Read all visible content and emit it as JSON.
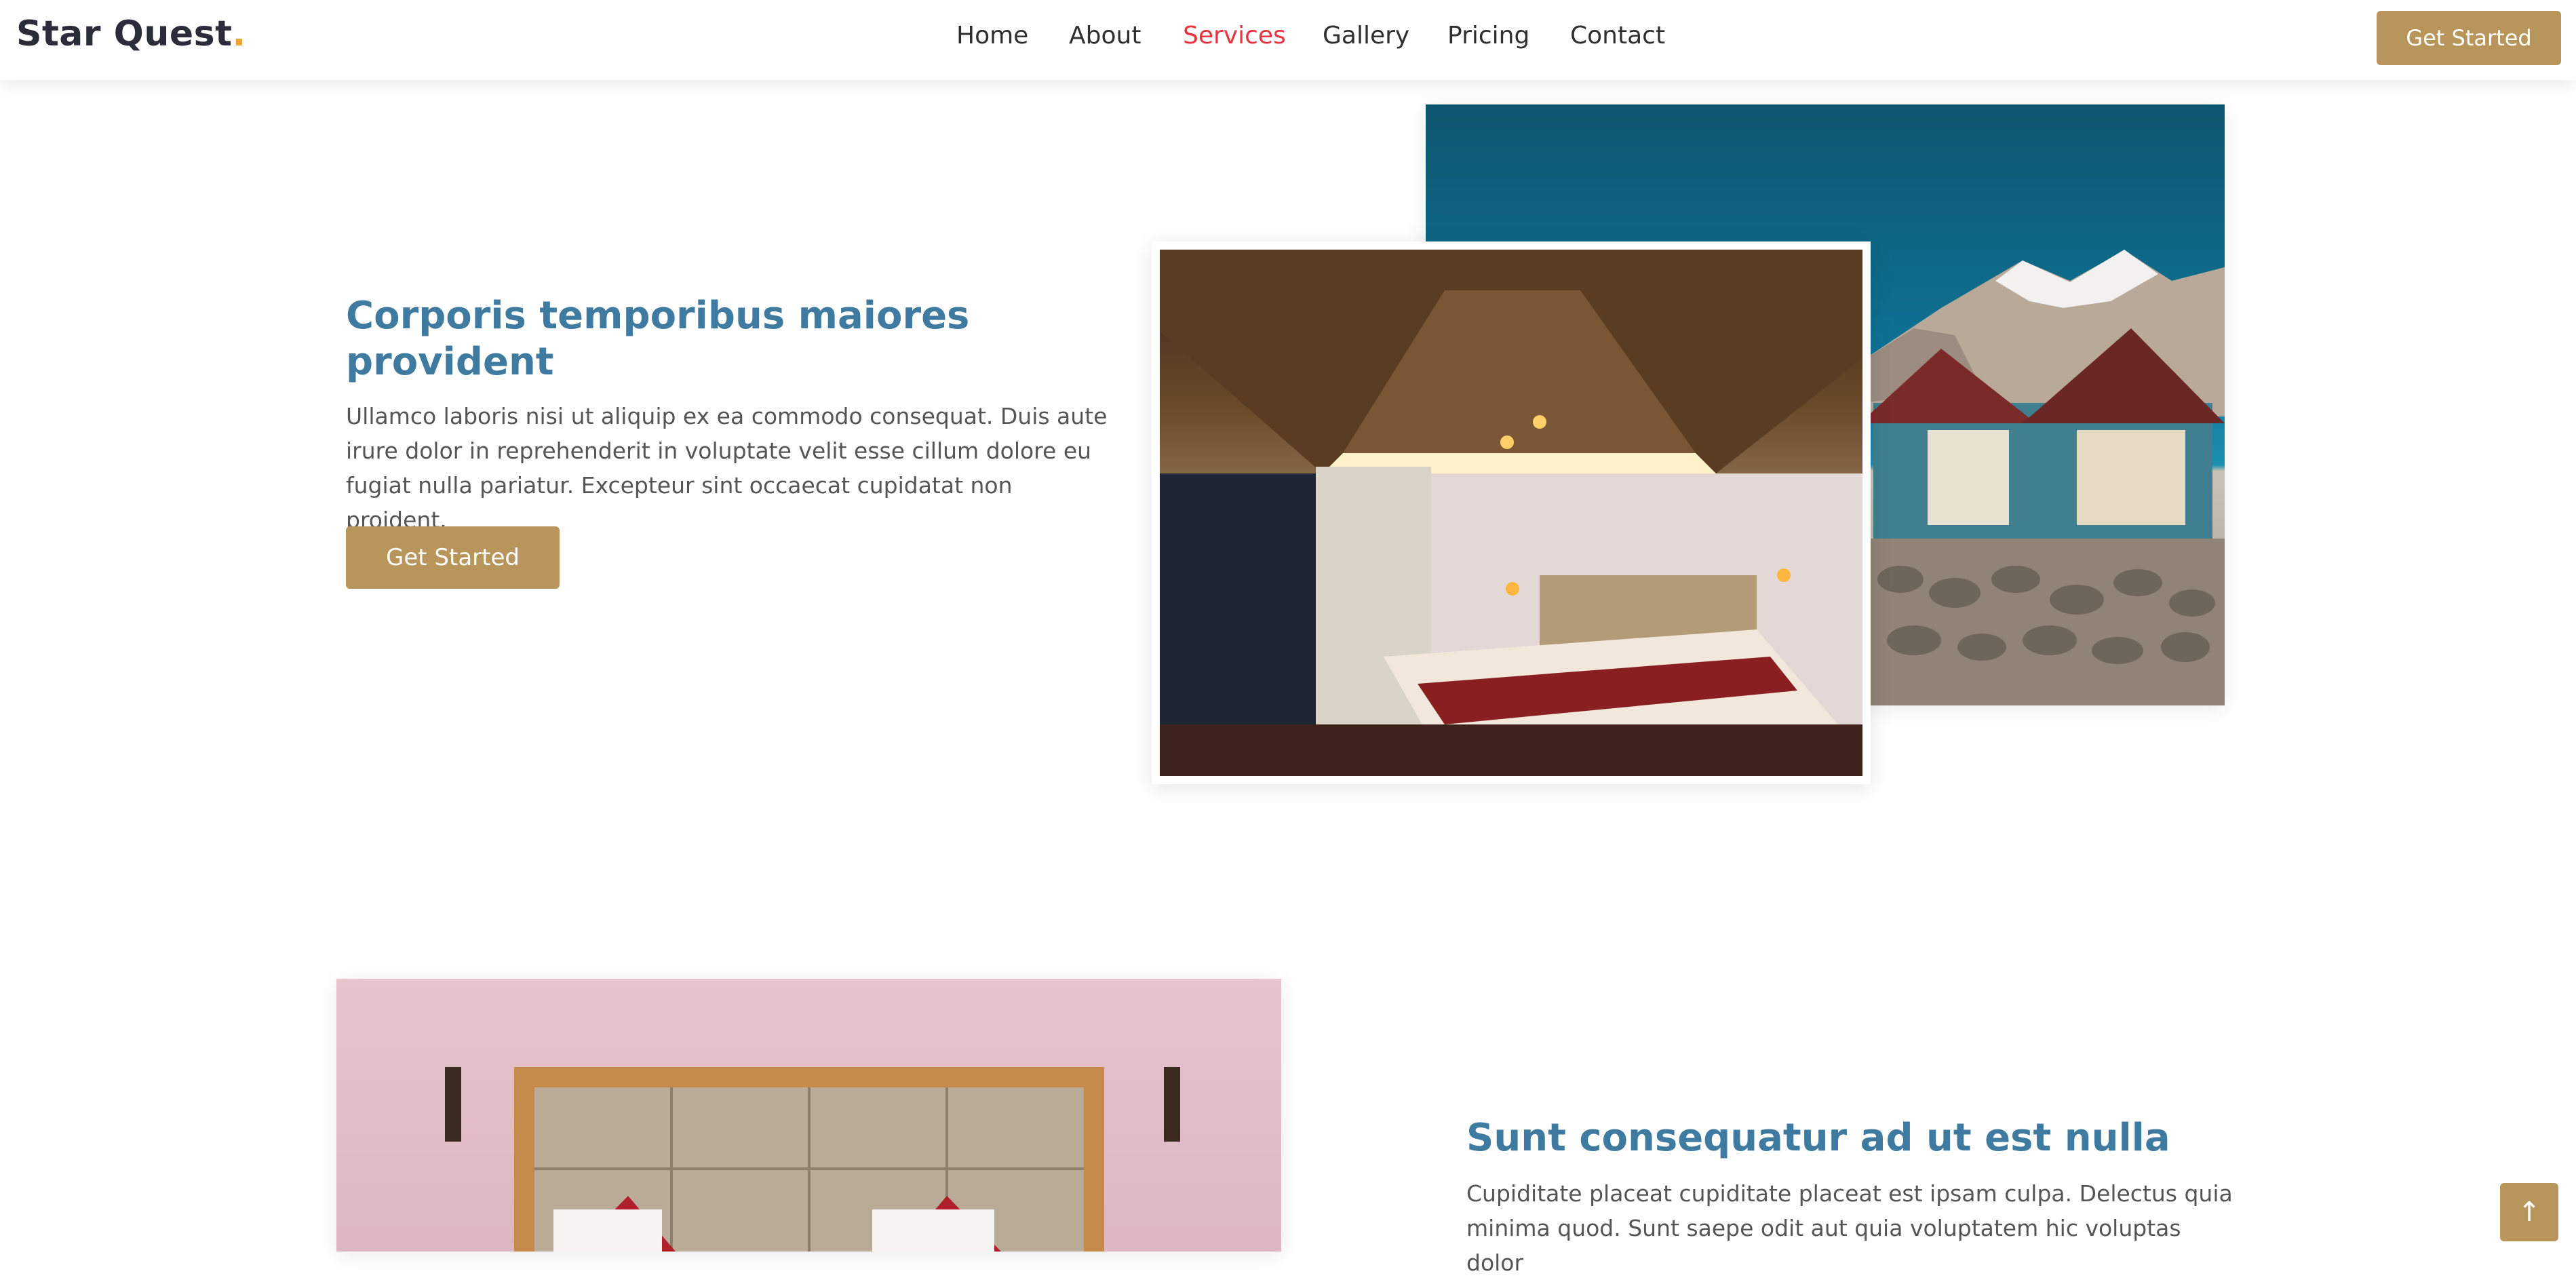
{
  "header": {
    "logo_text": "Star Quest",
    "logo_dot": ".",
    "nav": [
      {
        "label": "Home",
        "active": false
      },
      {
        "label": "About",
        "active": false
      },
      {
        "label": "Services",
        "active": true
      },
      {
        "label": "Gallery",
        "active": false
      },
      {
        "label": "Pricing",
        "active": false
      },
      {
        "label": "Contact",
        "active": false
      }
    ],
    "cta_label": "Get Started"
  },
  "feature_1": {
    "title": "Corporis temporibus maiores provident",
    "text": "Ullamco laboris nisi ut aliquip ex ea commodo consequat. Duis aute irure dolor in reprehenderit in voluptate velit esse cillum dolore eu fugiat nulla pariatur. Excepteur sint occaecat cupidatat non proident.",
    "button_label": "Get Started"
  },
  "feature_2": {
    "title": "Sunt consequatur ad ut est nulla",
    "text": "Cupiditate placeat cupiditate placeat est ipsam culpa. Delectus quia minima quod. Sunt saepe odit aut quia voluptatem hic voluptas dolor"
  },
  "back_to_top_icon": "arrow-up-icon",
  "colors": {
    "accent": "#b8955a",
    "heading": "#3f7ba0",
    "nav_active": "#e7343f",
    "logo_dot": "#e9a234"
  }
}
